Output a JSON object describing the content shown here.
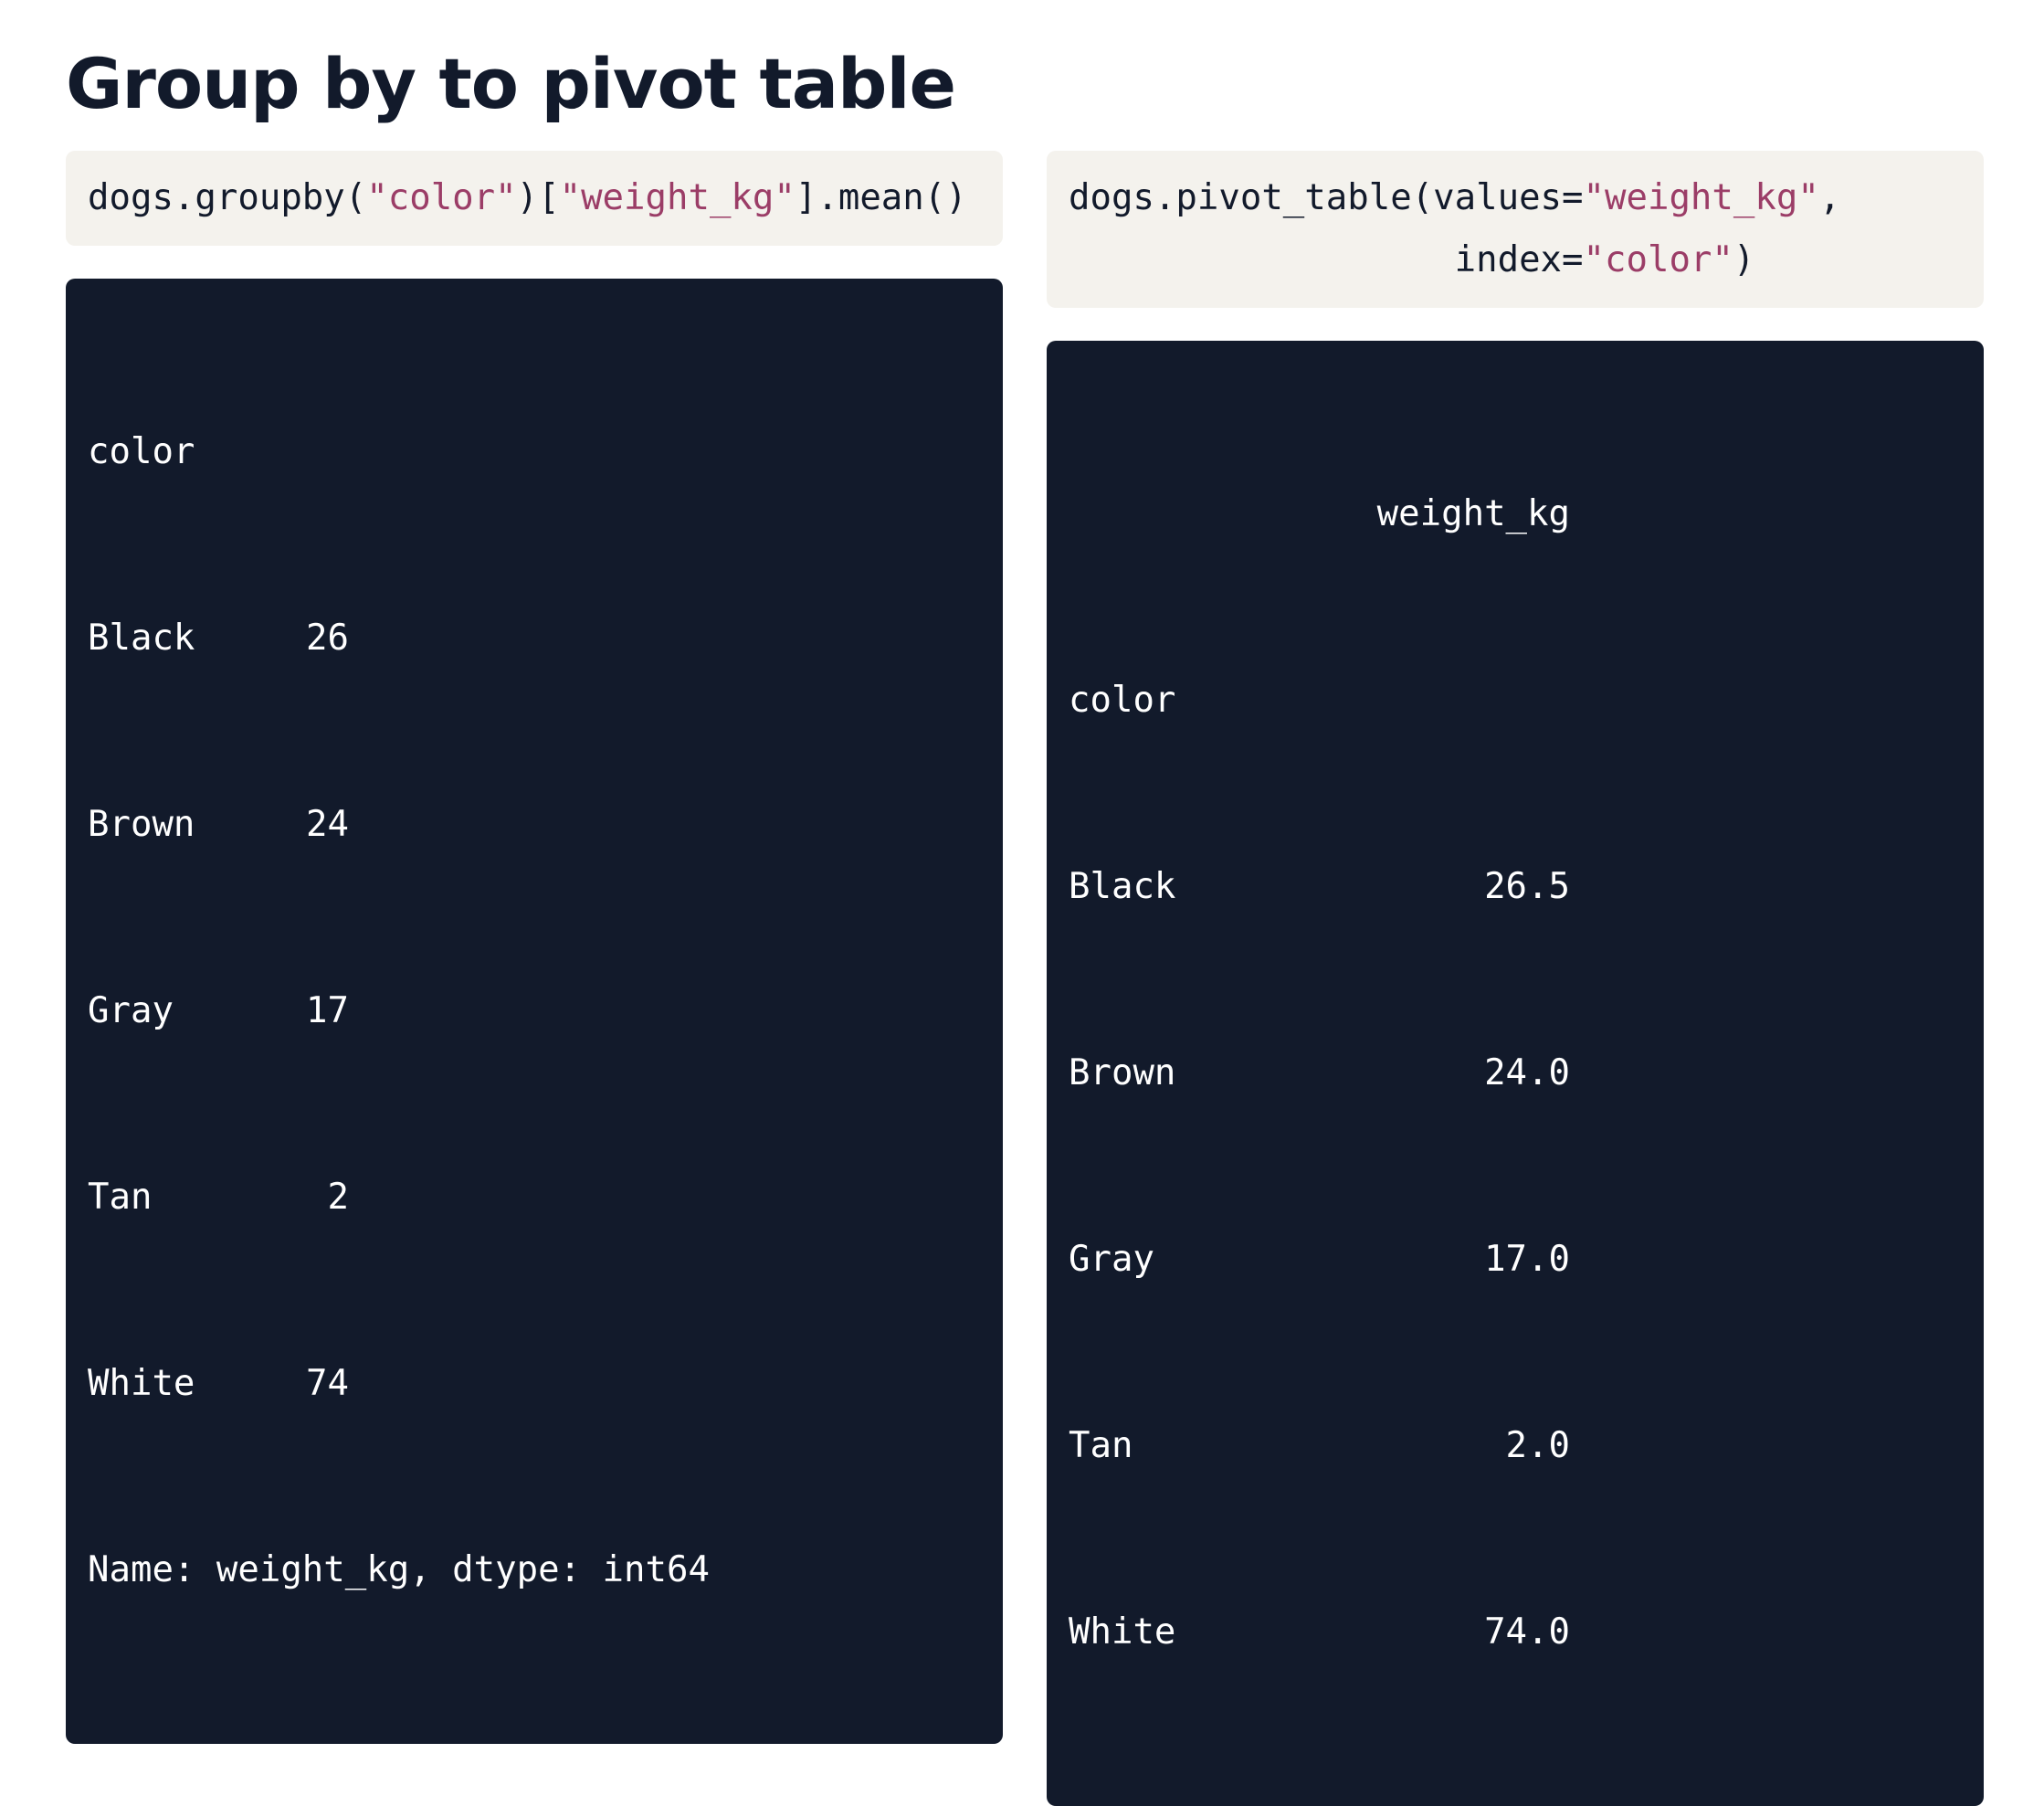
{
  "title": "Group by to pivot table",
  "left": {
    "code": {
      "prefix": "dogs.groupby(",
      "arg1": "\"color\"",
      "mid": ")[",
      "arg2": "\"weight_kg\"",
      "suffix": "].mean()"
    },
    "output": {
      "index_name": "color",
      "rows": [
        {
          "label": "Black",
          "value": "26"
        },
        {
          "label": "Brown",
          "value": "24"
        },
        {
          "label": "Gray",
          "value": "17"
        },
        {
          "label": "Tan",
          "value": "2"
        },
        {
          "label": "White",
          "value": "74"
        }
      ],
      "footer": "Name: weight_kg, dtype: int64"
    }
  },
  "right": {
    "code": {
      "line1_prefix": "dogs.pivot_table(values=",
      "line1_arg": "\"weight_kg\"",
      "line1_suffix": ",",
      "line2_indent": "                  ",
      "line2_prefix": "index=",
      "line2_arg": "\"color\"",
      "line2_suffix": ")"
    },
    "output": {
      "column_header": "weight_kg",
      "index_name": "color",
      "rows": [
        {
          "label": "Black",
          "value": "26.5"
        },
        {
          "label": "Brown",
          "value": "24.0"
        },
        {
          "label": "Gray",
          "value": "17.0"
        },
        {
          "label": "Tan",
          "value": "2.0"
        },
        {
          "label": "White",
          "value": "74.0"
        }
      ]
    }
  }
}
